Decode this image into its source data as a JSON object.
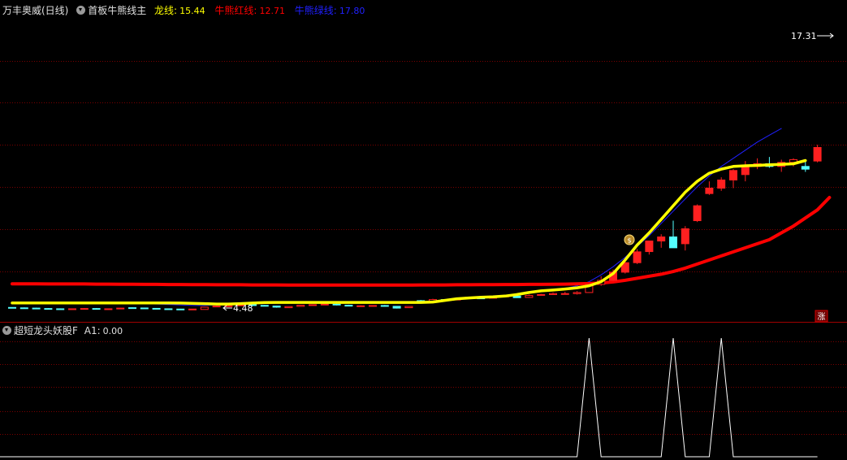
{
  "main_panel": {
    "stock_name": "万丰奥威(日线)",
    "indicator_name": "首板牛熊线主",
    "long_line_label": "龙线:",
    "long_line_value": "15.44",
    "red_line_label": "牛熊红线:",
    "red_line_value": "12.71",
    "blue_line_label": "牛熊绿线:",
    "blue_line_value": "17.80",
    "high_marker": "17.31",
    "low_marker": "4.48",
    "rise_badge": "涨",
    "colors": {
      "long_line": "#ffff00",
      "red_line": "#ff0000",
      "blue_line": "#2020ff",
      "up_candle": "#ff2020",
      "down_candle": "#54ffff",
      "grid": "#8b0000"
    }
  },
  "sub_panel": {
    "indicator_name": "超短龙头妖股F",
    "a1_label": "A1:",
    "a1_value": "0.00"
  },
  "candles": [
    {
      "o": 4.6,
      "h": 4.62,
      "l": 4.55,
      "c": 4.57
    },
    {
      "o": 4.57,
      "h": 4.6,
      "l": 4.52,
      "c": 4.55
    },
    {
      "o": 4.55,
      "h": 4.58,
      "l": 4.5,
      "c": 4.52
    },
    {
      "o": 4.52,
      "h": 4.55,
      "l": 4.48,
      "c": 4.5
    },
    {
      "o": 4.5,
      "h": 4.53,
      "l": 4.46,
      "c": 4.48
    },
    {
      "o": 4.46,
      "h": 4.52,
      "l": 4.44,
      "c": 4.5
    },
    {
      "o": 4.48,
      "h": 4.55,
      "l": 4.45,
      "c": 4.52
    },
    {
      "o": 4.52,
      "h": 4.55,
      "l": 4.46,
      "c": 4.48
    },
    {
      "o": 4.48,
      "h": 4.52,
      "l": 4.45,
      "c": 4.5
    },
    {
      "o": 4.52,
      "h": 4.57,
      "l": 4.5,
      "c": 4.55
    },
    {
      "o": 4.58,
      "h": 4.6,
      "l": 4.54,
      "c": 4.56
    },
    {
      "o": 4.56,
      "h": 4.58,
      "l": 4.52,
      "c": 4.53
    },
    {
      "o": 4.53,
      "h": 4.55,
      "l": 4.48,
      "c": 4.5
    },
    {
      "o": 4.5,
      "h": 4.52,
      "l": 4.46,
      "c": 4.48
    },
    {
      "o": 4.48,
      "h": 4.5,
      "l": 4.43,
      "c": 4.45
    },
    {
      "o": 4.45,
      "h": 4.5,
      "l": 4.42,
      "c": 4.48
    },
    {
      "o": 4.45,
      "h": 4.62,
      "l": 4.44,
      "c": 4.62
    },
    {
      "o": 4.64,
      "h": 4.72,
      "l": 4.62,
      "c": 4.7
    },
    {
      "o": 4.72,
      "h": 4.74,
      "l": 4.7,
      "c": 4.72
    },
    {
      "o": 4.72,
      "h": 4.8,
      "l": 4.7,
      "c": 4.78
    },
    {
      "o": 4.8,
      "h": 4.85,
      "l": 4.72,
      "c": 4.75
    },
    {
      "o": 4.75,
      "h": 4.78,
      "l": 4.7,
      "c": 4.72
    },
    {
      "o": 4.7,
      "h": 4.72,
      "l": 4.58,
      "c": 4.62
    },
    {
      "o": 4.58,
      "h": 4.66,
      "l": 4.56,
      "c": 4.66
    },
    {
      "o": 4.68,
      "h": 4.78,
      "l": 4.67,
      "c": 4.76
    },
    {
      "o": 4.76,
      "h": 4.82,
      "l": 4.74,
      "c": 4.8
    },
    {
      "o": 4.82,
      "h": 4.86,
      "l": 4.78,
      "c": 4.84
    },
    {
      "o": 4.84,
      "h": 4.88,
      "l": 4.75,
      "c": 4.78
    },
    {
      "o": 4.76,
      "h": 4.8,
      "l": 4.7,
      "c": 4.72
    },
    {
      "o": 4.72,
      "h": 4.76,
      "l": 4.7,
      "c": 4.72
    },
    {
      "o": 4.68,
      "h": 4.76,
      "l": 4.66,
      "c": 4.74
    },
    {
      "o": 4.74,
      "h": 4.78,
      "l": 4.66,
      "c": 4.68
    },
    {
      "o": 4.68,
      "h": 4.7,
      "l": 4.52,
      "c": 4.55
    },
    {
      "o": 4.58,
      "h": 4.67,
      "l": 4.58,
      "c": 4.67
    },
    {
      "o": 5.1,
      "h": 5.15,
      "l": 5.02,
      "c": 5.05
    },
    {
      "o": 5.05,
      "h": 5.24,
      "l": 5.02,
      "c": 5.18
    },
    {
      "o": 5.18,
      "h": 5.22,
      "l": 5.1,
      "c": 5.15
    },
    {
      "o": 5.15,
      "h": 5.28,
      "l": 5.12,
      "c": 5.25
    },
    {
      "o": 5.28,
      "h": 5.4,
      "l": 5.25,
      "c": 5.35
    },
    {
      "o": 5.3,
      "h": 5.36,
      "l": 5.22,
      "c": 5.26
    },
    {
      "o": 5.28,
      "h": 5.4,
      "l": 5.26,
      "c": 5.38
    },
    {
      "o": 5.4,
      "h": 5.48,
      "l": 5.38,
      "c": 5.44
    },
    {
      "o": 5.44,
      "h": 5.5,
      "l": 5.3,
      "c": 5.32
    },
    {
      "o": 5.34,
      "h": 5.55,
      "l": 5.32,
      "c": 5.48
    },
    {
      "o": 5.52,
      "h": 5.6,
      "l": 5.5,
      "c": 5.55
    },
    {
      "o": 5.55,
      "h": 5.7,
      "l": 5.53,
      "c": 5.62
    },
    {
      "o": 5.6,
      "h": 5.75,
      "l": 5.58,
      "c": 5.62
    },
    {
      "o": 5.62,
      "h": 5.8,
      "l": 5.55,
      "c": 5.7
    },
    {
      "o": 5.7,
      "h": 6.35,
      "l": 5.68,
      "c": 6.3
    },
    {
      "o": 6.3,
      "h": 6.9,
      "l": 6.2,
      "c": 6.6
    },
    {
      "o": 6.6,
      "h": 7.4,
      "l": 6.55,
      "c": 7.2
    },
    {
      "o": 7.2,
      "h": 8.1,
      "l": 7.1,
      "c": 7.9
    },
    {
      "o": 7.9,
      "h": 8.9,
      "l": 7.8,
      "c": 8.7
    },
    {
      "o": 8.72,
      "h": 9.5,
      "l": 8.5,
      "c": 9.5
    },
    {
      "o": 9.5,
      "h": 10.0,
      "l": 9.0,
      "c": 9.8
    },
    {
      "o": 9.8,
      "h": 11.0,
      "l": 9.2,
      "c": 9.0
    },
    {
      "o": 9.3,
      "h": 10.6,
      "l": 8.8,
      "c": 10.4
    },
    {
      "o": 11.0,
      "h": 12.2,
      "l": 10.9,
      "c": 12.1
    },
    {
      "o": 13.0,
      "h": 13.9,
      "l": 12.9,
      "c": 13.4
    },
    {
      "o": 13.4,
      "h": 14.2,
      "l": 13.2,
      "c": 14.0
    },
    {
      "o": 14.0,
      "h": 14.8,
      "l": 13.4,
      "c": 14.7
    },
    {
      "o": 14.4,
      "h": 15.4,
      "l": 13.9,
      "c": 15.0
    },
    {
      "o": 15.0,
      "h": 15.6,
      "l": 14.8,
      "c": 15.2
    },
    {
      "o": 15.2,
      "h": 15.7,
      "l": 14.9,
      "c": 15.0
    },
    {
      "o": 15.0,
      "h": 15.5,
      "l": 14.6,
      "c": 15.3
    },
    {
      "o": 15.3,
      "h": 15.6,
      "l": 15.0,
      "c": 15.5
    },
    {
      "o": 15.0,
      "h": 15.4,
      "l": 14.6,
      "c": 14.8
    },
    {
      "o": 15.4,
      "h": 16.6,
      "l": 15.3,
      "c": 16.4
    }
  ],
  "long_line": [
    4.93,
    4.93,
    4.93,
    4.93,
    4.93,
    4.93,
    4.93,
    4.93,
    4.93,
    4.93,
    4.93,
    4.93,
    4.93,
    4.93,
    4.92,
    4.9,
    4.88,
    4.85,
    4.85,
    4.88,
    4.92,
    4.96,
    4.97,
    4.97,
    4.97,
    4.97,
    4.97,
    4.97,
    4.97,
    4.97,
    4.97,
    4.97,
    4.97,
    4.97,
    4.97,
    5.0,
    5.12,
    5.24,
    5.3,
    5.35,
    5.38,
    5.44,
    5.55,
    5.7,
    5.82,
    5.88,
    5.96,
    6.05,
    6.2,
    6.5,
    7.1,
    8.1,
    9.2,
    10.1,
    11.1,
    12.1,
    13.1,
    13.9,
    14.5,
    14.8,
    15.0,
    15.05,
    15.08,
    15.12,
    15.15,
    15.2,
    15.44
  ],
  "red_line": [
    6.34,
    6.34,
    6.34,
    6.33,
    6.33,
    6.33,
    6.33,
    6.32,
    6.32,
    6.31,
    6.31,
    6.3,
    6.3,
    6.29,
    6.29,
    6.28,
    6.28,
    6.27,
    6.27,
    6.27,
    6.26,
    6.26,
    6.26,
    6.25,
    6.25,
    6.25,
    6.25,
    6.25,
    6.25,
    6.25,
    6.25,
    6.25,
    6.25,
    6.25,
    6.26,
    6.26,
    6.26,
    6.27,
    6.27,
    6.28,
    6.28,
    6.29,
    6.29,
    6.3,
    6.3,
    6.31,
    6.32,
    6.34,
    6.36,
    6.4,
    6.48,
    6.6,
    6.75,
    6.9,
    7.05,
    7.25,
    7.5,
    7.8,
    8.1,
    8.4,
    8.7,
    9.0,
    9.3,
    9.6,
    10.1,
    10.6,
    11.2,
    11.8,
    12.71
  ],
  "blue_line": [
    4.95,
    4.95,
    4.95,
    4.94,
    4.94,
    4.93,
    4.93,
    4.92,
    4.92,
    4.91,
    4.9,
    4.88,
    4.85,
    4.82,
    4.78,
    4.74,
    4.74,
    4.8,
    4.9,
    4.95,
    4.98,
    4.97,
    4.97,
    4.97,
    4.97,
    4.98,
    4.98,
    4.98,
    4.98,
    4.98,
    4.98,
    4.98,
    4.98,
    4.98,
    4.98,
    5.02,
    5.12,
    5.2,
    5.28,
    5.34,
    5.4,
    5.48,
    5.56,
    5.66,
    5.76,
    5.86,
    6.0,
    6.2,
    6.5,
    7.0,
    7.6,
    8.3,
    9.1,
    9.9,
    10.8,
    11.7,
    12.6,
    13.5,
    14.3,
    15.0,
    15.6,
    16.2,
    16.8,
    17.31,
    17.8
  ],
  "signals": [
    {
      "i": 48,
      "a1": 1
    },
    {
      "i": 55,
      "a1": 1
    },
    {
      "i": 59,
      "a1": 1
    },
    {
      "i": 68,
      "a1": 1
    }
  ]
}
